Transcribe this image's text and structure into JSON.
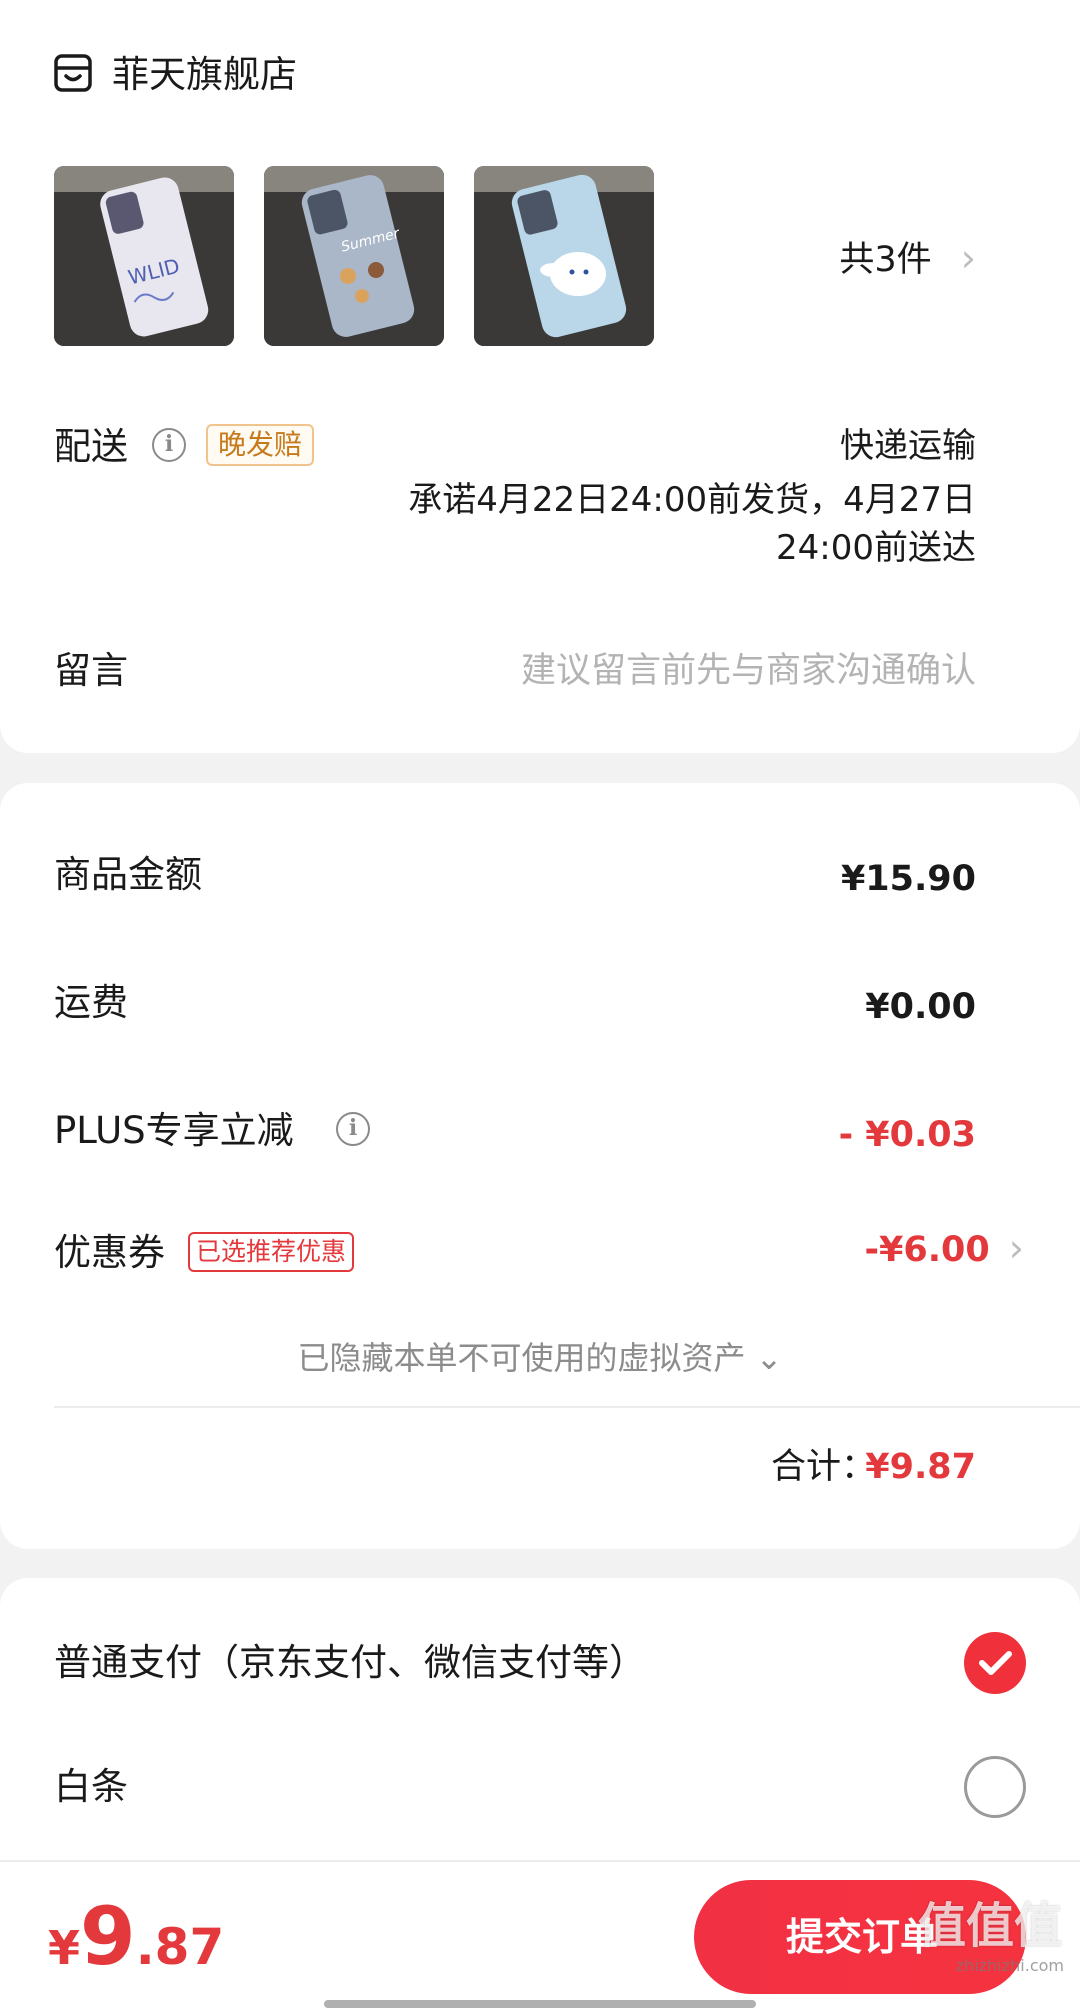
{
  "shop": {
    "name": "菲天旗舰店",
    "icon": "shop-icon"
  },
  "products": {
    "thumbnails": [
      {
        "name": "product-thumb-1",
        "theme": "graffiti clear case"
      },
      {
        "name": "product-thumb-2",
        "theme": "summer bear case"
      },
      {
        "name": "product-thumb-3",
        "theme": "cinnamoroll case"
      }
    ],
    "count_label": "共3件",
    "chevron": "›"
  },
  "delivery": {
    "label": "配送",
    "badge": "晚发赔",
    "method": "快递运输",
    "promise_line1": "承诺4月22日24:00前发货，4月27日",
    "promise_line2": "24:00前送达"
  },
  "message": {
    "label": "留言",
    "placeholder": "建议留言前先与商家沟通确认"
  },
  "summary": {
    "goods_label": "商品金额",
    "goods_value": "¥15.90",
    "shipping_label": "运费",
    "shipping_value": "¥0.00",
    "plus_label": "PLUS专享立减",
    "plus_value": "- ¥0.03",
    "coupon_label": "优惠券",
    "coupon_badge": "已选推荐优惠",
    "coupon_value": "-¥6.00",
    "hidden_note": "已隐藏本单不可使用的虚拟资产 ⌄",
    "total_label": "合计：",
    "total_value": "¥9.87"
  },
  "payment": {
    "normal_label": "普通支付（京东支付、微信支付等）",
    "normal_selected": true,
    "baitiao_label": "白条",
    "baitiao_selected": false
  },
  "bottom": {
    "currency": "¥",
    "price_int": "9",
    "price_dec": ".87",
    "submit_label": "提交订单",
    "watermark": "值值值",
    "watermark_sub": "zhizhizhi.com"
  },
  "colors": {
    "accent": "#e4393c",
    "button": "#f23044",
    "badge_orange": "#c77a1b"
  }
}
